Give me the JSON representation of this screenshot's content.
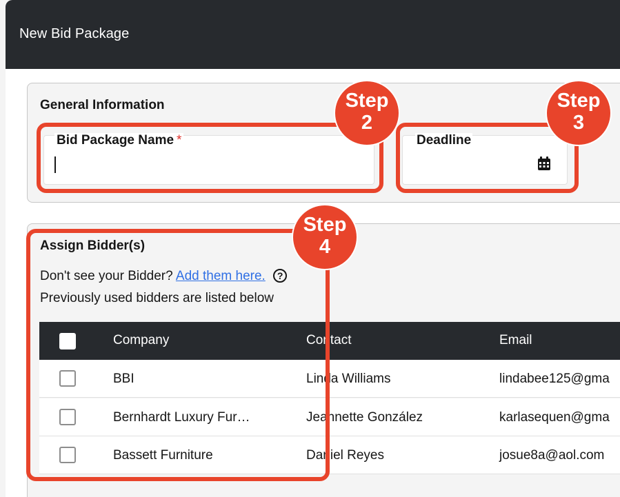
{
  "header": {
    "title": "New Bid Package"
  },
  "general": {
    "title": "General Information",
    "name_label": "Bid Package Name",
    "required_mark": "*",
    "name_value": "",
    "deadline_label": "Deadline",
    "deadline_value": ""
  },
  "bidders": {
    "title": "Assign Bidder(s)",
    "hint_prefix": "Don't see your Bidder?",
    "hint_link": "Add them here.",
    "help_glyph": "?",
    "subtitle": "Previously used bidders are listed below",
    "columns": [
      "Company",
      "Contact",
      "Email"
    ],
    "rows": [
      {
        "company": "BBI",
        "contact": "Linda Williams",
        "email": "lindabee125@gma"
      },
      {
        "company": "Bernhardt Luxury Fur…",
        "contact": "Jeannette González",
        "email": "karlasequen@gma"
      },
      {
        "company": "Bassett Furniture",
        "contact": "Daniel Reyes",
        "email": "josue8a@aol.com"
      }
    ]
  },
  "annotations": [
    {
      "word": "Step",
      "number": "2"
    },
    {
      "word": "Step",
      "number": "3"
    },
    {
      "word": "Step",
      "number": "4"
    }
  ],
  "colors": {
    "header_bg": "#272a2e",
    "highlight": "#e8442b",
    "link": "#2f6fe4",
    "required": "#e0312b"
  },
  "icons": [
    "calendar-icon",
    "help-circle-icon",
    "checkbox-icon"
  ]
}
